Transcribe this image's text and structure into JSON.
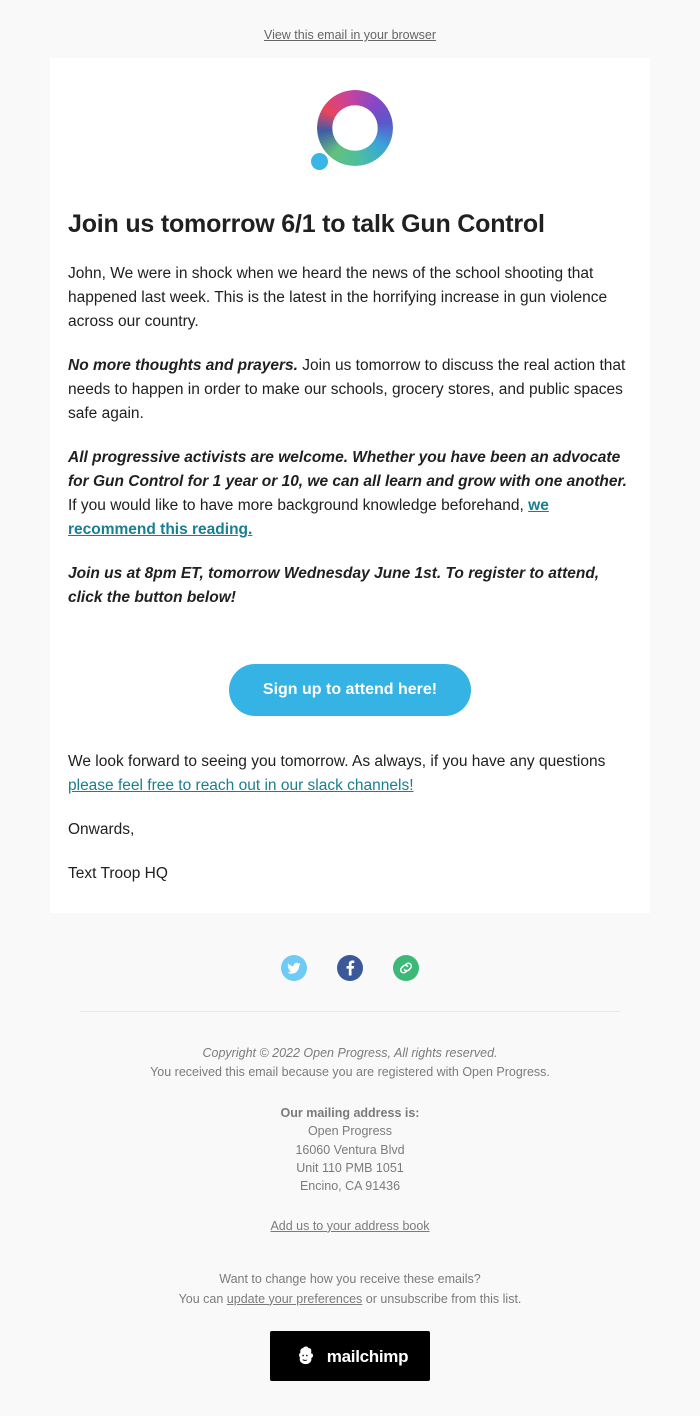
{
  "preheader": {
    "link_text": "View this email in your browser"
  },
  "logo": {
    "icon": "open-progress-ring-logo",
    "colors": {
      "red": "#e8455e",
      "purple": "#8b46c6",
      "blue": "#3aa7d8",
      "green": "#4dbf9e",
      "dot": "#38b6e8"
    }
  },
  "email": {
    "headline": "Join us tomorrow 6/1 to talk Gun Control",
    "paragraph_1": "John, We were in shock when we heard the news of the school shooting that happened last week. This is the latest in the horrifying increase in gun violence across our country.",
    "paragraph_2_bold": "No more thoughts and prayers.",
    "paragraph_2_rest": " Join us tomorrow to discuss the real action that needs to happen in order to make our schools, grocery stores, and public spaces safe again.",
    "paragraph_3_bold": "All progressive activists are welcome. Whether you have been an advocate for Gun Control for 1 year or 10, we can all learn and grow with one another.",
    "paragraph_3_rest": " If you would like to have more background knowledge beforehand, ",
    "paragraph_3_link": "we recommend this reading.",
    "paragraph_4": "Join us at 8pm ET, tomorrow Wednesday June 1st. To register to attend, click the button below!",
    "cta_label": "Sign up to attend here!",
    "cta_color": "#34b3e4",
    "closing_line": "We look forward to seeing you tomorrow. As always, if you have any questions ",
    "closing_link": "please feel free to reach out in our slack channels!",
    "signoff": "Onwards,",
    "signature": "Text Troop HQ",
    "link_color": "#167f92"
  },
  "social": [
    {
      "name": "twitter",
      "icon": "twitter-icon",
      "color": "#6ecbf5"
    },
    {
      "name": "facebook",
      "icon": "facebook-icon",
      "color": "#3b5998"
    },
    {
      "name": "website",
      "icon": "link-icon",
      "color": "#3cb878"
    }
  ],
  "footer": {
    "copyright": "Copyright © 2022 Open Progress, All rights reserved.",
    "registered_line": "You received this email because you are registered with Open Progress.",
    "mailing_title": "Our mailing address is:",
    "address_line_1": "Open Progress",
    "address_line_2": "16060 Ventura Blvd",
    "address_line_3": "Unit 110 PMB 1051",
    "address_line_4": "Encino, CA 91436",
    "address_book_link": "Add us to your address book",
    "prefs_question": "Want to change how you receive these emails?",
    "prefs_prefix": "You can ",
    "prefs_link": "update your preferences",
    "prefs_suffix": " or unsubscribe from this list.",
    "mailchimp_wordmark": "mailchimp"
  }
}
